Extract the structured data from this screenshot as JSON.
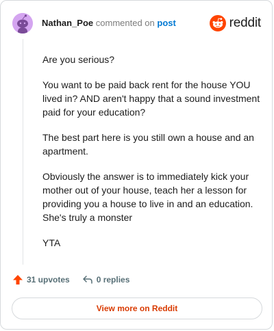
{
  "header": {
    "username": "Nathan_Poe",
    "action_text": "commented on",
    "post_link": "post",
    "brand_name": "reddit"
  },
  "comment": {
    "paragraphs": [
      "Are you serious?",
      "You want to be paid back rent for the house YOU lived in? AND aren't happy that a sound investment paid for your education?",
      "The best part here is you still own a house and an apartment.",
      "Obviously the answer is to immediately kick your mother out of your house, teach her a lesson for providing you a house to live in and an education. She's truly a monster",
      "YTA"
    ]
  },
  "actions": {
    "upvotes_label": "31 upvotes",
    "replies_label": "0 replies"
  },
  "footer": {
    "view_more_label": "View more on Reddit"
  },
  "icons": {
    "upvote": "upvote-arrow-icon",
    "reply": "reply-arrow-icon",
    "brand": "reddit-logo-icon",
    "avatar": "snoo-avatar-icon"
  },
  "colors": {
    "accent": "#d93a00",
    "upvote": "#ff4500",
    "link": "#0079d3",
    "avatar_bg": "#d4a5f0"
  }
}
